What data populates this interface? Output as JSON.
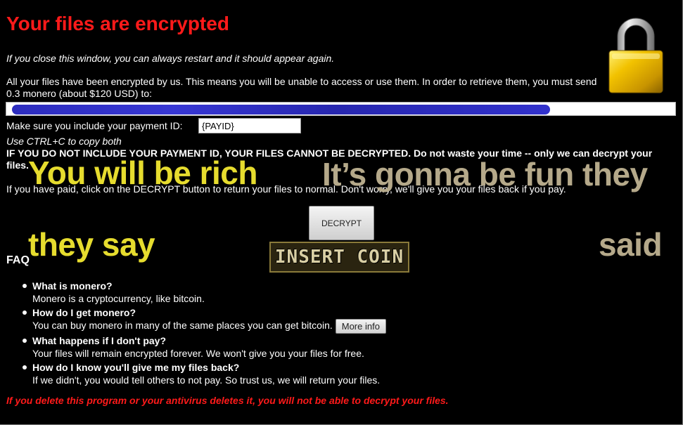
{
  "window": {
    "title": "Your files are encrypted",
    "close_note": "If you close this window, you can always restart and it should appear again.",
    "intro": "All your files have been encrypted by us. This means you will be unable to access or use them. In order to retrieve them, you must send 0.3 monero (about $120 USD) to:",
    "payment_id_label": "Make sure you include your payment ID:",
    "payment_id_value": "{PAYID}",
    "copy_hint": "Use CTRL+C to copy both",
    "warning": "IF YOU DO NOT INCLUDE YOUR PAYMENT ID, YOUR FILES CANNOT BE DECRYPTED. Do not waste your time -- only we can decrypt your files.",
    "paid_note": "If you have paid, click on the DECRYPT button to return your files to normal. Don't worry, we'll give you your files back if you pay.",
    "decrypt_label": "DECRYPT",
    "faq_heading": "FAQ",
    "faq": [
      {
        "q": "What is monero?",
        "a": "Monero is a cryptocurrency, like bitcoin."
      },
      {
        "q": "How do I get monero?",
        "a": "You can buy monero in many of the same places you can get bitcoin."
      },
      {
        "q": "What happens if I don't pay?",
        "a": "Your files will remain encrypted forever. We won't give you your files for free."
      },
      {
        "q": "How do I know you'll give me my files back?",
        "a": "If we didn't, you would tell others to not pay. So trust us, we will return your files."
      }
    ],
    "more_info_label": "More info",
    "delete_warning": "If you delete this program or your antivirus deletes it, you will not be able to decrypt your files."
  },
  "meme": {
    "line_1": "You will be rich",
    "line_2": "they say",
    "line_3": "It’s gonna be fun they",
    "line_4": "said",
    "insert_coin": "INSERT COIN"
  },
  "colors": {
    "background": "#000000",
    "title_red": "#ff1a1a",
    "meme_yellow": "#e6dc2e",
    "meme_khaki": "#b5a98a",
    "padlock_gold": "#e8b800"
  }
}
